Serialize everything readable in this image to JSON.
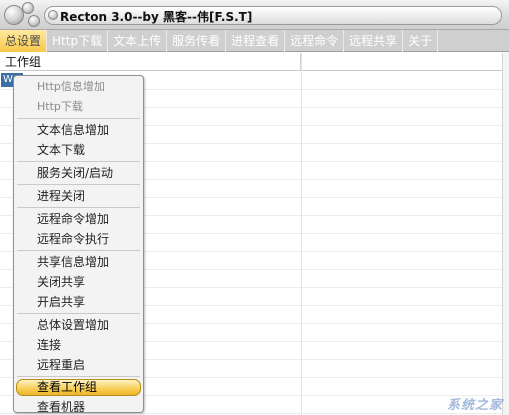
{
  "window": {
    "title": "Recton 3.0--by 黑客--伟[F.S.T]"
  },
  "menubar": {
    "items": [
      {
        "label": "总设置",
        "active": true
      },
      {
        "label": "Http下载"
      },
      {
        "label": "文本上传"
      },
      {
        "label": "服务传看"
      },
      {
        "label": "进程查看"
      },
      {
        "label": "远程命令"
      },
      {
        "label": "远程共享"
      },
      {
        "label": "关于"
      }
    ]
  },
  "table": {
    "columns": [
      "工作组",
      ""
    ],
    "selected_row_text": "W"
  },
  "context_menu": {
    "groups": [
      [
        {
          "label": "Http信息增加",
          "disabled": true
        },
        {
          "label": "Http下载",
          "disabled": true
        }
      ],
      [
        {
          "label": "文本信息增加"
        },
        {
          "label": "文本下载"
        }
      ],
      [
        {
          "label": "服务关闭/启动"
        }
      ],
      [
        {
          "label": "进程关闭"
        }
      ],
      [
        {
          "label": "远程命令增加"
        },
        {
          "label": "远程命令执行"
        }
      ],
      [
        {
          "label": "共享信息增加"
        },
        {
          "label": "关闭共享"
        },
        {
          "label": "开启共享"
        }
      ],
      [
        {
          "label": "总体设置增加"
        },
        {
          "label": "连接"
        },
        {
          "label": "远程重启"
        }
      ],
      [
        {
          "label": "查看工作组",
          "highlight": true
        },
        {
          "label": "查看机器"
        }
      ]
    ]
  },
  "watermark": "系统之家"
}
